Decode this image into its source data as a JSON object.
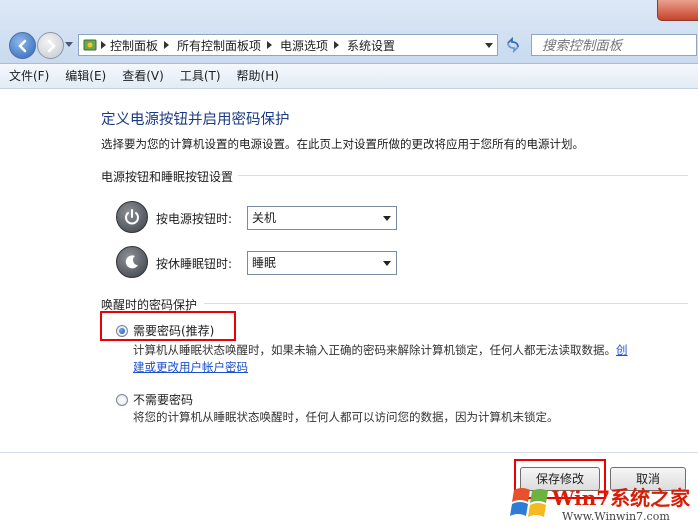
{
  "address_bar": {
    "crumbs": [
      "控制面板",
      "所有控制面板项",
      "电源选项",
      "系统设置"
    ]
  },
  "search": {
    "placeholder": "搜索控制面板"
  },
  "menu": [
    "文件(F)",
    "编辑(E)",
    "查看(V)",
    "工具(T)",
    "帮助(H)"
  ],
  "page": {
    "title": "定义电源按钮并启用密码保护",
    "description": "选择要为您的计算机设置的电源设置。在此页上对设置所做的更改将应用于您所有的电源计划。"
  },
  "power_section": {
    "title": "电源按钮和睡眠按钮设置",
    "power_button": {
      "label": "按电源按钮时:",
      "value": "关机"
    },
    "sleep_button": {
      "label": "按休睡眠钮时:",
      "value": "睡眠"
    }
  },
  "password_section": {
    "title": "唤醒时的密码保护",
    "require": {
      "label": "需要密码(推荐)",
      "desc": "计算机从睡眠状态唤醒时，如果未输入正确的密码来解除计算机锁定，任何人都无法读取数据。",
      "link_part1": "创",
      "link_part2": "建或更改用户帐户密码",
      "selected": true
    },
    "no_require": {
      "label": "不需要密码",
      "desc": "将您的计算机从睡眠状态唤醒时，任何人都可以访问您的数据，因为计算机未锁定。",
      "selected": false
    }
  },
  "buttons": {
    "save": "保存修改",
    "cancel": "取消"
  },
  "watermark": {
    "brand": "Win7系统之家",
    "url": "Www.Winwin7.com"
  },
  "colors": {
    "title": "#1b3a84",
    "link": "#1a4fcf",
    "highlight": "#e00000"
  }
}
